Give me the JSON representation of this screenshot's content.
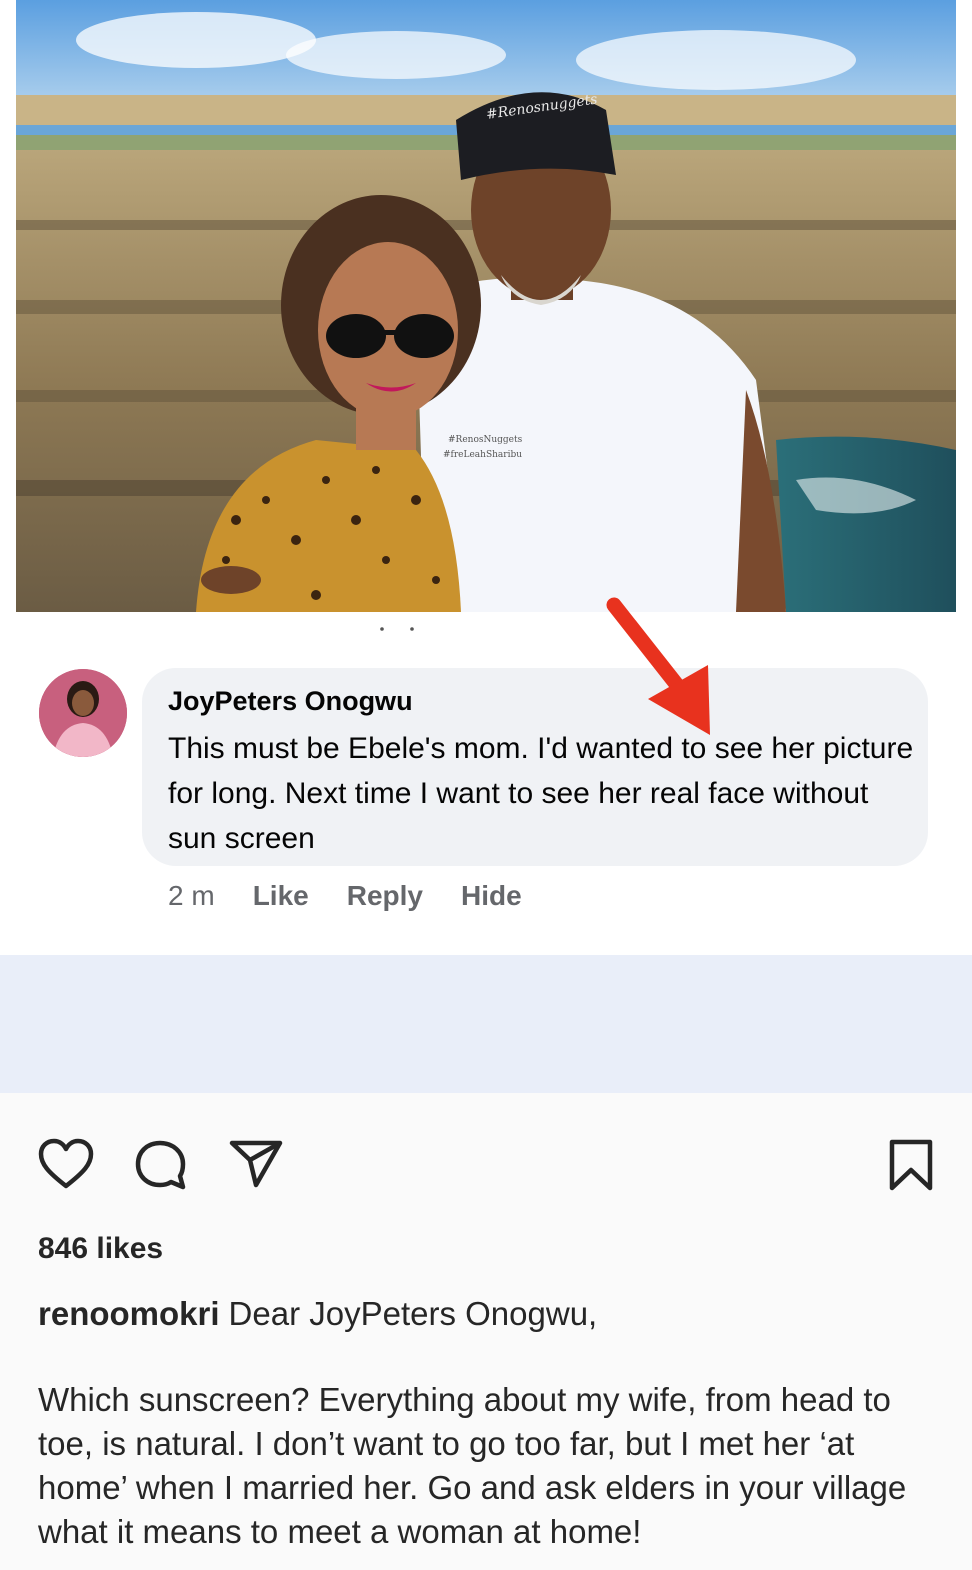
{
  "comment": {
    "author": "JoyPeters Onogwu",
    "text": "This must be Ebele's mom. I'd wanted to see her picture for long. Next time I want to see her real face without sun screen",
    "time": "2 m",
    "actions": [
      "Like",
      "Reply",
      "Hide"
    ]
  },
  "photo": {
    "cap_text": "#Renosnuggets",
    "shirt_line1": "#RenosNuggets",
    "shirt_line2": "#freLeahSharibu"
  },
  "post": {
    "likes": "846 likes",
    "username": "renoomokri",
    "caption_first": "Dear JoyPeters Onogwu,",
    "caption_body": "Which sunscreen? Everything about my wife, from head to toe, is natural. I don’t want to go too far, but I met her ‘at home’ when I married her. Go and ask elders in your village what it means to meet a woman at home!"
  },
  "icons": [
    "heart-icon",
    "comment-icon",
    "share-icon",
    "bookmark-icon",
    "arrow-icon"
  ],
  "colors": {
    "arrow": "#e8321e",
    "bubble": "#f0f2f5",
    "band": "#e9eef9",
    "muted": "#65676b"
  }
}
